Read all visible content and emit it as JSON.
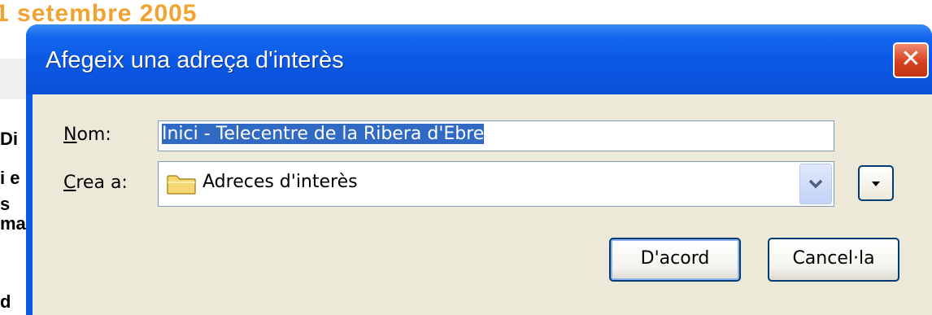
{
  "background": {
    "heading": "1 setembre 2005",
    "text_fragments": [
      "Di",
      "i e",
      "s",
      "ma",
      "d"
    ]
  },
  "dialog": {
    "title": "Afegeix una adreça d'interès",
    "close_symbol": "✕",
    "name_label": "Nom:",
    "name_value": "Inici - Telecentre de la Ribera d'Ebre",
    "create_in_label": "Crea a:",
    "folder_value": "Adreces d'interès",
    "folder_icon": "folder-icon",
    "ok_label": "D'acord",
    "cancel_label": "Cancel·la"
  },
  "colors": {
    "titlebar": "#0a58e4",
    "client_bg": "#ece9d8",
    "selection": "#316ac5",
    "heading_orange": "#f0a330",
    "close_red": "#d8421e"
  }
}
